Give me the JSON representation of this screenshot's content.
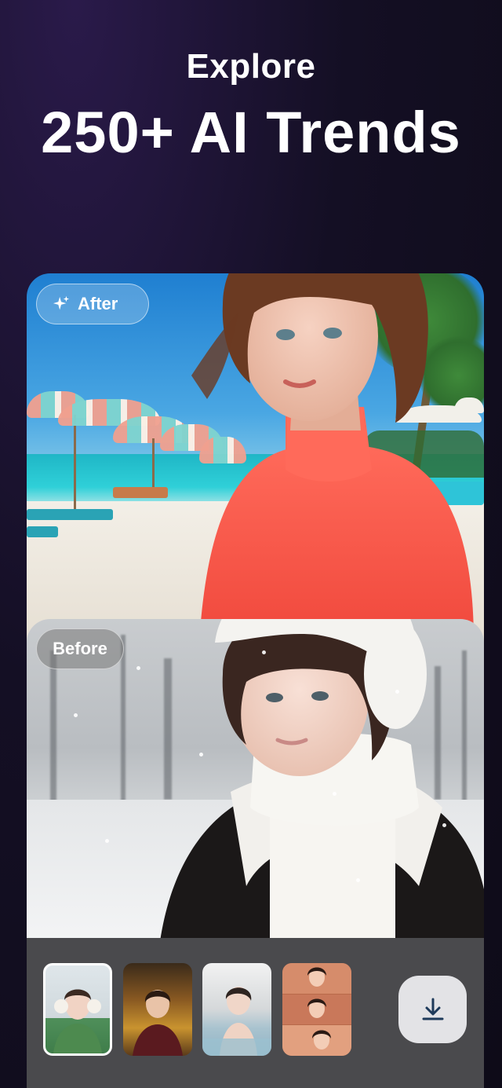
{
  "header": {
    "subtitle": "Explore",
    "title": "250+ AI Trends"
  },
  "compare": {
    "after_label": "After",
    "before_label": "Before"
  },
  "thumbnails": [
    {
      "name": "earmuffs-green-sweater",
      "selected": true
    },
    {
      "name": "golden-palace-portrait",
      "selected": false
    },
    {
      "name": "snow-hot-spring",
      "selected": false
    },
    {
      "name": "warm-collage",
      "selected": false
    }
  ],
  "actions": {
    "download_icon": "download-icon"
  },
  "colors": {
    "background": "#140f24",
    "bar": "#4a4a4d",
    "download_button": "#e3e3e6",
    "icon": "#1e3a5a"
  }
}
